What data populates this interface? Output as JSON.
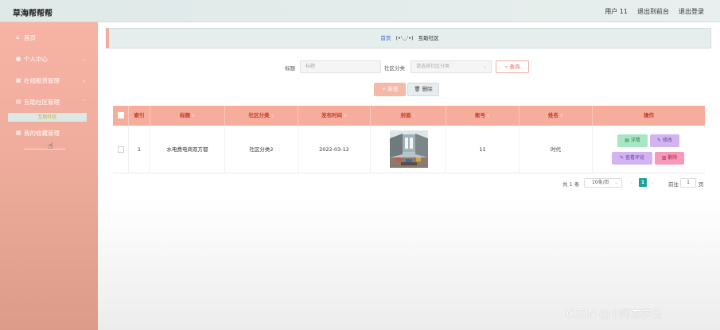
{
  "header": {
    "brand": "草海帮帮帮",
    "user": "用户 11",
    "back_front": "退出到前台",
    "logout": "退出登录"
  },
  "sidebar": {
    "items": [
      {
        "label": "首页",
        "icon": "home-icon"
      },
      {
        "label": "个人中心",
        "icon": "user-icon"
      },
      {
        "label": "在线租赁管理",
        "icon": "grid-icon"
      },
      {
        "label": "互助社区管理",
        "icon": "folder-icon"
      },
      {
        "label": "我的收藏管理",
        "icon": "grid-icon"
      }
    ],
    "sub_item": "互助社区"
  },
  "breadcrumb": {
    "home": "首页",
    "emoticon": "(•'◡'•)",
    "current": "互助社区"
  },
  "search": {
    "title_label": "标题",
    "title_placeholder": "标题",
    "category_label": "社区分类",
    "category_placeholder": "请选择社区分类",
    "search_button": "查询"
  },
  "actions": {
    "add": "新增",
    "delete": "删除"
  },
  "table": {
    "columns": [
      "索引",
      "标题",
      "社区分类",
      "发布时间",
      "封面",
      "账号",
      "姓名",
      "操作"
    ],
    "rows": [
      {
        "index": "1",
        "title": "水电费电商双方都",
        "category": "社区分类2",
        "date": "2022-03-12",
        "account": "11",
        "name": "时代"
      }
    ],
    "ops": {
      "detail": "详情",
      "edit": "修改",
      "comments": "查看评论",
      "delete": "删除"
    }
  },
  "pagination": {
    "total": "共 1 条",
    "page_size": "10条/页",
    "current_page": "1",
    "goto_prefix": "前往",
    "goto_value": "1",
    "goto_suffix": "页"
  },
  "watermark": "CSDN @小阿杰学长",
  "colors": {
    "accent": "#f6ad9b",
    "sidebar": "#f0ad9d",
    "pager_active": "#1fa198"
  }
}
